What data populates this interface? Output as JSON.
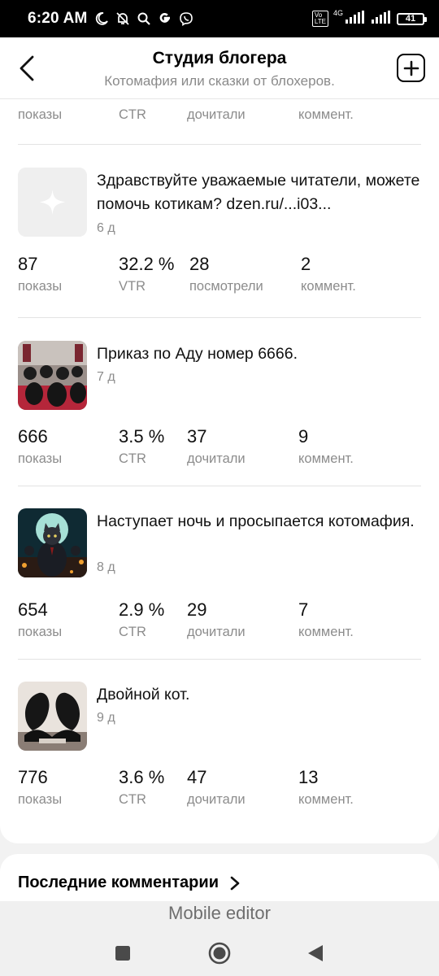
{
  "status_bar": {
    "time": "6:20 AM",
    "network": "4G",
    "battery": "41",
    "icons": [
      "moon-icon",
      "bell-off-icon",
      "search-icon",
      "google-icon",
      "viber-icon",
      "volte-icon",
      "signal-icon",
      "battery-icon"
    ]
  },
  "header": {
    "title": "Студия блогера",
    "subtitle": "Котомафия или сказки от блохеров."
  },
  "cut_row": {
    "stats": [
      {
        "label": "показы"
      },
      {
        "label": "CTR"
      },
      {
        "label": "дочитали"
      },
      {
        "label": "коммент."
      }
    ]
  },
  "posts": [
    {
      "title": "Здравствуйте уважаемые читатели, можете помочь котикам? dzen.ru/...i03...",
      "age": "6 д",
      "thumb": "placeholder",
      "stats": [
        {
          "value": "87",
          "label": "показы"
        },
        {
          "value": "32.2 %",
          "label": "VTR"
        },
        {
          "value": "28",
          "label": "посмотрели"
        },
        {
          "value": "2",
          "label": "коммент."
        }
      ]
    },
    {
      "title": "Приказ по Аду номер 6666.",
      "age": "7 д",
      "thumb": "cats-rows",
      "stats": [
        {
          "value": "666",
          "label": "показы"
        },
        {
          "value": "3.5 %",
          "label": "CTR"
        },
        {
          "value": "37",
          "label": "дочитали"
        },
        {
          "value": "9",
          "label": "коммент."
        }
      ]
    },
    {
      "title": "Наступает ночь и просыпается котомафия.",
      "age": "8 д",
      "thumb": "cat-mafia",
      "stats": [
        {
          "value": "654",
          "label": "показы"
        },
        {
          "value": "2.9 %",
          "label": "CTR"
        },
        {
          "value": "29",
          "label": "дочитали"
        },
        {
          "value": "7",
          "label": "коммент."
        }
      ]
    },
    {
      "title": "Двойной кот.",
      "age": "9 д",
      "thumb": "double-cat",
      "stats": [
        {
          "value": "776",
          "label": "показы"
        },
        {
          "value": "3.6 %",
          "label": "CTR"
        },
        {
          "value": "47",
          "label": "дочитали"
        },
        {
          "value": "13",
          "label": "коммент."
        }
      ]
    }
  ],
  "comments": {
    "title": "Последние комментарии"
  },
  "editor_bar": {
    "label": "Mobile editor"
  },
  "colors": {
    "status_bar": "#000000",
    "muted_text": "#8c8c8c",
    "page_bg": "#f2f2f2"
  }
}
